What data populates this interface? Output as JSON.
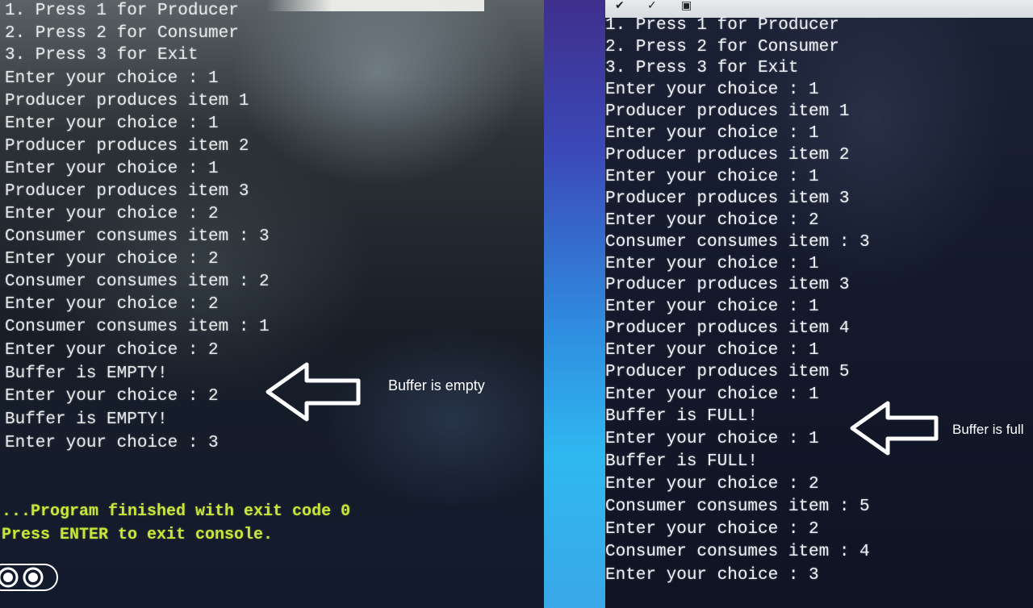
{
  "left_console": {
    "lines": [
      "1. Press 1 for Producer",
      "2. Press 2 for Consumer",
      "3. Press 3 for Exit",
      "Enter your choice : 1",
      "Producer produces item 1",
      "Enter your choice : 1",
      "Producer produces item 2",
      "Enter your choice : 1",
      "Producer produces item 3",
      "Enter your choice : 2",
      "Consumer consumes item : 3",
      "Enter your choice : 2",
      "Consumer consumes item : 2",
      "Enter your choice : 2",
      "Consumer consumes item : 1",
      "Enter your choice : 2",
      "Buffer is EMPTY!",
      "Enter your choice : 2",
      "Buffer is EMPTY!",
      "Enter your choice : 3"
    ],
    "footer": {
      "finished": "...Program finished with exit code 0",
      "press_enter": "Press ENTER to exit console."
    },
    "annotation": "Buffer is empty"
  },
  "right_console": {
    "lines": [
      "1. Press 1 for Producer",
      "2. Press 2 for Consumer",
      "3. Press 3 for Exit",
      "Enter your choice : 1",
      "Producer produces item 1",
      "Enter your choice : 1",
      "Producer produces item 2",
      "Enter your choice : 1",
      "Producer produces item 3",
      "Enter your choice : 2",
      "Consumer consumes item : 3",
      "Enter your choice : 1",
      "Producer produces item 3",
      "Enter your choice : 1",
      "Producer produces item 4",
      "Enter your choice : 1",
      "Producer produces item 5",
      "Enter your choice : 1",
      "Buffer is FULL!",
      "Enter your choice : 1",
      "Buffer is FULL!",
      "Enter your choice : 2",
      "Consumer consumes item : 5",
      "Enter your choice : 2",
      "Consumer consumes item : 4",
      "Enter your choice : 3"
    ],
    "annotation": "Buffer is full"
  },
  "colors": {
    "console_text": "#e6e8ea",
    "exit_text": "#c8e63a",
    "annotation": "#ffffff"
  },
  "icons": [
    "left-arrow-icon",
    "circle-button-icon"
  ]
}
